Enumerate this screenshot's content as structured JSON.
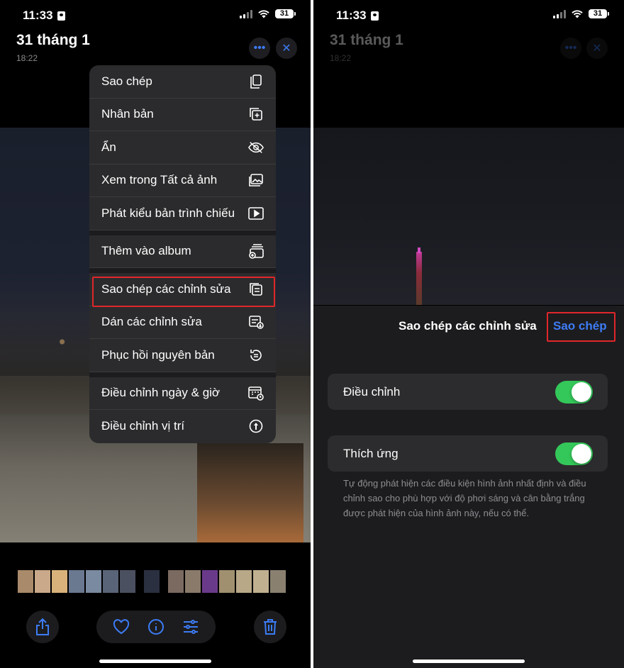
{
  "left": {
    "status": {
      "time": "11:33",
      "battery": "31"
    },
    "header": {
      "title": "31 tháng 1",
      "time": "18:22"
    },
    "menu": {
      "groups": [
        [
          {
            "label": "Sao chép",
            "icon": "copy-icon"
          },
          {
            "label": "Nhân bản",
            "icon": "duplicate-icon"
          },
          {
            "label": "Ẩn",
            "icon": "eye-slash-icon"
          },
          {
            "label": "Xem trong Tất cả ảnh",
            "icon": "photos-icon"
          },
          {
            "label": "Phát kiểu bản trình chiếu",
            "icon": "play-icon"
          }
        ],
        [
          {
            "label": "Thêm vào album",
            "icon": "add-to-album-icon"
          }
        ],
        [
          {
            "label": "Sao chép các chỉnh sửa",
            "icon": "copy-edits-icon"
          },
          {
            "label": "Dán các chỉnh sửa",
            "icon": "paste-edits-icon"
          },
          {
            "label": "Phục hồi nguyên bản",
            "icon": "revert-icon"
          }
        ],
        [
          {
            "label": "Điều chỉnh ngày & giờ",
            "icon": "calendar-clock-icon"
          },
          {
            "label": "Điều chỉnh vị trí",
            "icon": "location-icon"
          }
        ]
      ]
    },
    "toolbar": {
      "share": "share-icon",
      "favorite": "heart-icon",
      "info": "info-icon",
      "adjust": "sliders-icon",
      "delete": "trash-icon"
    }
  },
  "right": {
    "status": {
      "time": "11:33",
      "battery": "31"
    },
    "header": {
      "title": "31 tháng 1",
      "time": "18:22"
    },
    "sheet": {
      "title": "Sao chép các chỉnh sửa",
      "action": "Sao chép",
      "rows": [
        {
          "label": "Điều chỉnh",
          "on": true
        },
        {
          "label": "Thích ứng",
          "on": true
        }
      ],
      "description": "Tự động phát hiện các điều kiện hình ảnh nhất định và điều chỉnh sao cho phù hợp với độ phơi sáng và cân bằng trắng được phát hiện của hình ảnh này, nếu có thể."
    }
  },
  "colors": {
    "accent": "#3d7cf5",
    "toggle_on": "#34c759",
    "highlight": "#e0262a"
  }
}
